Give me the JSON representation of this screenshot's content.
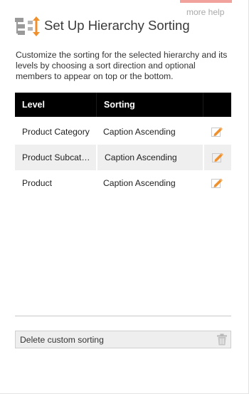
{
  "header": {
    "title": "Set Up Hierarchy Sorting",
    "icon": "hierarchy-sort-icon",
    "help_link": "more help"
  },
  "description": "Customize the sorting for the selected hierarchy and its levels by choosing a sort direction and optional members to appear on top or the bottom.",
  "grid": {
    "columns": [
      "Level",
      "Sorting",
      ""
    ],
    "rows": [
      {
        "level": "Product Category",
        "sorting": "Caption Ascending",
        "action_icon": "edit-icon"
      },
      {
        "level": "Product Subcategory",
        "sorting": "Caption Ascending",
        "action_icon": "edit-icon"
      },
      {
        "level": "Product",
        "sorting": "Caption Ascending",
        "action_icon": "edit-icon"
      }
    ]
  },
  "footer": {
    "delete_label": "Delete custom sorting",
    "delete_icon": "trash-icon"
  },
  "colors": {
    "accent": "#f0902c",
    "header_bg": "#000000",
    "alt_row_bg": "#efefef",
    "help_link": "#a9a9a9",
    "top_accent": "#f2a29d"
  }
}
